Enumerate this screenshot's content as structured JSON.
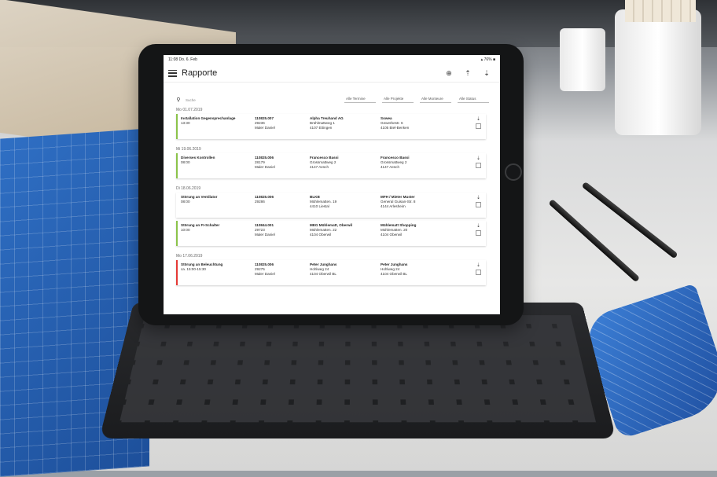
{
  "app": {
    "title": "Rapporte",
    "status_left": "11:08  Do. 6. Feb",
    "status_right": "▴ 76% ■"
  },
  "toolbar": {
    "add_icon": "plus-circle-icon",
    "upload_icon": "upload-icon",
    "download_icon": "download-icon"
  },
  "filters": {
    "search_placeholder": "Suche",
    "items": [
      "Alle Termine",
      "Alle Projekte",
      "Alle Monteure",
      "Alle Status"
    ]
  },
  "days": [
    {
      "label": "Mo 01.07.2019",
      "reports": [
        {
          "color": "#8bc34a",
          "title": "Installation Gegensprechanlage",
          "time": "13:30",
          "number": "110825.007",
          "code": "29236",
          "person": "Maler Daniel",
          "a_name": "Alpha Treuhand AG",
          "a_street": "Brühlmattweg 1",
          "a_city": "4107 Ettingen",
          "b_name": "Sowea",
          "b_street": "Gewerbestr. 6",
          "b_city": "4105 Biel-Benken"
        }
      ]
    },
    {
      "label": "Mi 19.06.2019",
      "reports": [
        {
          "color": "#8bc34a",
          "title": "Diverses Kontrollen",
          "time": "08:00",
          "number": "110825.006",
          "code": "28179",
          "person": "Maler Daniel",
          "a_name": "Francesco Bassi",
          "a_street": "Grossmattweg 2",
          "a_city": "4147 Aesch",
          "b_name": "Francesco Bassi",
          "b_street": "Grossmattweg 2",
          "b_city": "4147 Aesch"
        }
      ]
    },
    {
      "label": "Di 18.06.2019",
      "reports": [
        {
          "color": "#ffffff",
          "title": "Störung an Ventilator",
          "time": "08:00",
          "number": "110825.006",
          "code": "29286",
          "person": "",
          "a_name": "BLKB",
          "a_street": "Mühlematten. 19",
          "a_city": "4410 Liestal",
          "b_name": "MFH / Mieter Muster",
          "b_street": "General Guisan-Str. 8",
          "b_city": "4144 Arlesheim"
        },
        {
          "color": "#8bc34a",
          "title": "Störung an FI-Schalter",
          "time": "10:00",
          "number": "110844.001",
          "code": "29723",
          "person": "Maler Daniel",
          "a_name": "MEG Mühlematt, Oberwil",
          "a_street": "Mühlematten. 22",
          "a_city": "4104 Oberwil",
          "b_name": "Mühlematt Shopping",
          "b_street": "Mühlematten. 20",
          "b_city": "4104 Oberwil"
        }
      ]
    },
    {
      "label": "Mo 17.06.2019",
      "reports": [
        {
          "color": "#e53935",
          "title": "Störung an Beleuchtung",
          "time": "ca. 15:00-15:30",
          "number": "110825.006",
          "code": "29275",
          "person": "Maler Daniel",
          "a_name": "Peter Junghans",
          "a_street": "Hohlweg 24",
          "a_city": "4104 Oberwil BL",
          "b_name": "Peter Junghans",
          "b_street": "Hohlweg 24",
          "b_city": "4104 Oberwil BL"
        }
      ]
    }
  ]
}
